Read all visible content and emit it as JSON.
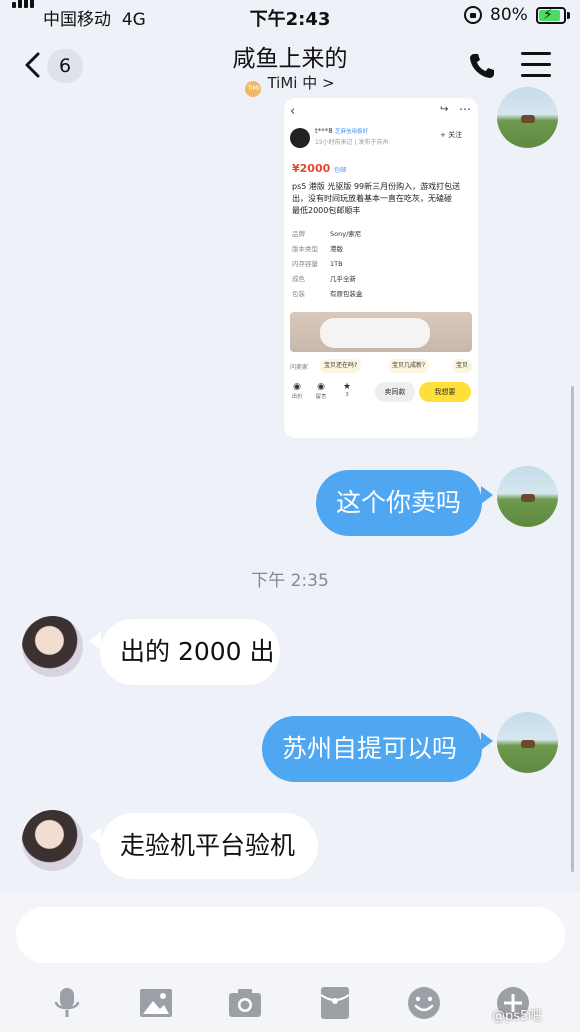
{
  "status_bar": {
    "carrier": "中国移动",
    "network": "4G",
    "time": "下午2:43",
    "battery": "80%",
    "battery_level": 0.8
  },
  "header": {
    "unread_count": "6",
    "title": "咸鱼上来的",
    "logo_text": "TiMi",
    "subtitle": "TiMi 中 >"
  },
  "listing": {
    "seller_name": "t***8",
    "seller_badge": "芝麻信用极好",
    "seller_meta": "15小时前来过 | 发布于苏州",
    "follow": "+ 关注",
    "price": "¥2000",
    "price_tag": "包邮",
    "description": "ps5 港版 光驱版 99新三月份购入，游戏打包送出，没有时间玩放着基本一直在吃灰，无磕碰\n最低2000包邮顺丰",
    "specs": [
      {
        "k": "品牌",
        "v": "Sony/索尼"
      },
      {
        "k": "版本类型",
        "v": "港版"
      },
      {
        "k": "内存容量",
        "v": "1TB"
      },
      {
        "k": "成色",
        "v": "几乎全新"
      },
      {
        "k": "包装",
        "v": "有原包装盒"
      }
    ],
    "quick_label": "问卖家",
    "quick_chips": [
      "宝贝还在吗?",
      "宝贝几成新?",
      "宝贝"
    ],
    "bottom_icons": [
      {
        "icon": "想要",
        "label": "出价"
      },
      {
        "icon": "留言",
        "label": "留言"
      },
      {
        "icon": "★",
        "label": "3"
      }
    ],
    "btn_same": "卖同款",
    "btn_want": "我想要"
  },
  "messages": [
    {
      "side": "out",
      "text": "这个你卖吗"
    },
    {
      "side": "in",
      "text": "出的 2000 出"
    },
    {
      "side": "out",
      "text": "苏州自提可以吗"
    },
    {
      "side": "in",
      "text": "走验机平台验机"
    }
  ],
  "timestamp": "下午 2:35",
  "input": {
    "placeholder": ""
  },
  "toolbar": [
    "microphone-icon",
    "image-icon",
    "camera-icon",
    "red-packet-icon",
    "emoji-icon",
    "plus-icon"
  ],
  "watermark": "@ps5吧",
  "colors": {
    "outgoing_bubble": "#4fa7f2",
    "background": "#eef1f7",
    "want_button": "#ffe03a",
    "price": "#e8452d"
  }
}
